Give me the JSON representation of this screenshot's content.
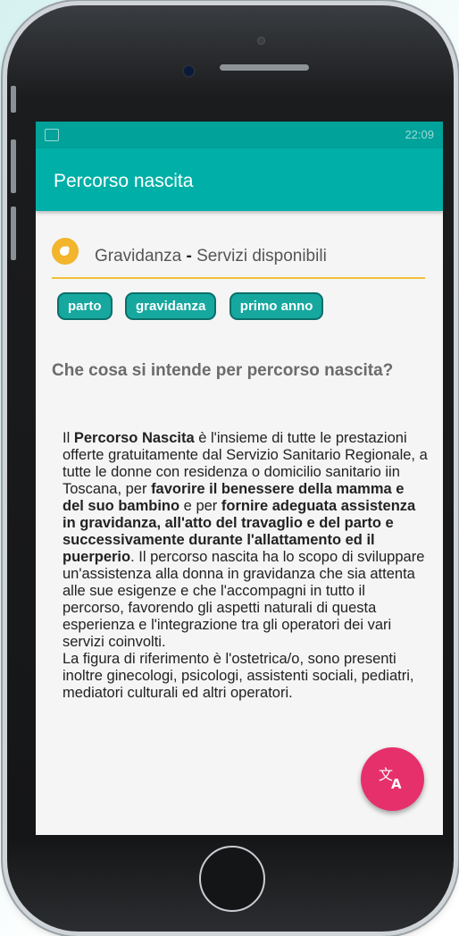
{
  "status_bar": {
    "right_text": "22:09"
  },
  "app_bar": {
    "title": "Percorso nascita"
  },
  "section": {
    "title_part1": "Gravidanza",
    "separator": "-",
    "title_part2": "Servizi disponibili",
    "icon": "fetus-icon",
    "accent": "#f2b52c"
  },
  "chips": [
    "parto",
    "gravidanza",
    "primo anno"
  ],
  "question": "Che cosa si intende per percorso nascita?",
  "paragraph": {
    "p1": "Il ",
    "b1": "Percorso Nascita",
    "p2": " è l'insieme di tutte le prestazioni offerte gratuitamente dal Servizio Sanitario Regionale, a tutte le donne con residenza  o domicilio sanitario iin Toscana, per ",
    "b2": "favorire il benessere della mamma e del suo bambino",
    "p3": " e per ",
    "b3": "fornire adeguata assistenza in gravidanza, all'atto del travaglio e del parto e successivamente durante l'allattamento ed il puerperio",
    "p4": ". Il percorso nascita ha lo scopo di sviluppare un'assistenza alla donna in gravidanza che sia attenta alle sue esigenze e che l'accompagni in tutto il percorso, favorendo gli aspetti naturali di questa esperienza e l'integrazione tra gli operatori dei vari servizi coinvolti.",
    "p5": "La figura di riferimento è l'ostetrica/o, sono presenti inoltre ginecologi, psicologi, assistenti sociali, pediatri, mediatori culturali ed altri operatori."
  },
  "fab": {
    "icon": "translate-icon",
    "color": "#e6306b"
  },
  "colors": {
    "primary": "#00b0a8",
    "chip": "#16a89f"
  }
}
